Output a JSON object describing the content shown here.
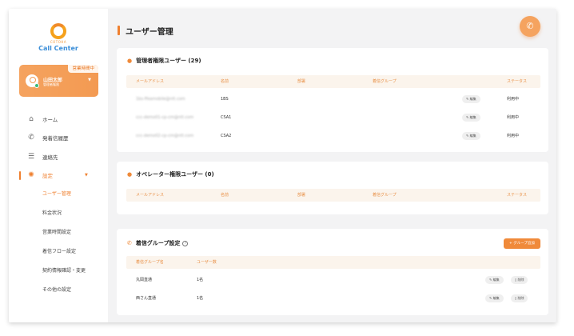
{
  "brand": {
    "top_text": "COTOHA",
    "name": "Call Center"
  },
  "user": {
    "status_badge": "営業時間中",
    "name": "山田太郎",
    "role": "管理者権限"
  },
  "nav": {
    "home": "ホーム",
    "history": "発着信履歴",
    "contacts": "連絡先",
    "settings": "設定",
    "sub": [
      "ユーザー管理",
      "料金状況",
      "営業時間設定",
      "着信フロー設定",
      "契約情報確認・変更",
      "その他の設定"
    ]
  },
  "page": {
    "title": "ユーザー管理"
  },
  "columns": {
    "email": "メールアドレス",
    "name": "名前",
    "department": "部署",
    "group": "着信グループ",
    "status": "ステータス"
  },
  "admins": {
    "title": "管理者権限ユーザー (29)",
    "rows": [
      {
        "email": "1bs-ffeamobile@ntt.com",
        "name": "1BS",
        "edit": "編集",
        "status": "利用中"
      },
      {
        "email": "ccc-demo01-cp-cm@ntt.com",
        "name": "CSA1",
        "edit": "編集",
        "status": "利用中"
      },
      {
        "email": "ccc-demo02-cp-cm@ntt.com",
        "name": "CSA2",
        "edit": "編集",
        "status": "利用中"
      }
    ]
  },
  "operators": {
    "title": "オペレーター権限ユーザー (0)"
  },
  "groups": {
    "title": "着信グループ設定",
    "help": "?",
    "add_button": "+ グループ追加",
    "col_name": "着信グループ名",
    "col_count": "ユーザー数",
    "rows": [
      {
        "name": "丸岡直通",
        "count": "1名",
        "edit": "編集",
        "delete": "削除"
      },
      {
        "name": "西さん直通",
        "count": "1名",
        "edit": "編集",
        "delete": "削除"
      }
    ]
  },
  "colors": {
    "accent": "#ef7f2e",
    "header_bg": "#fbf4ec"
  }
}
